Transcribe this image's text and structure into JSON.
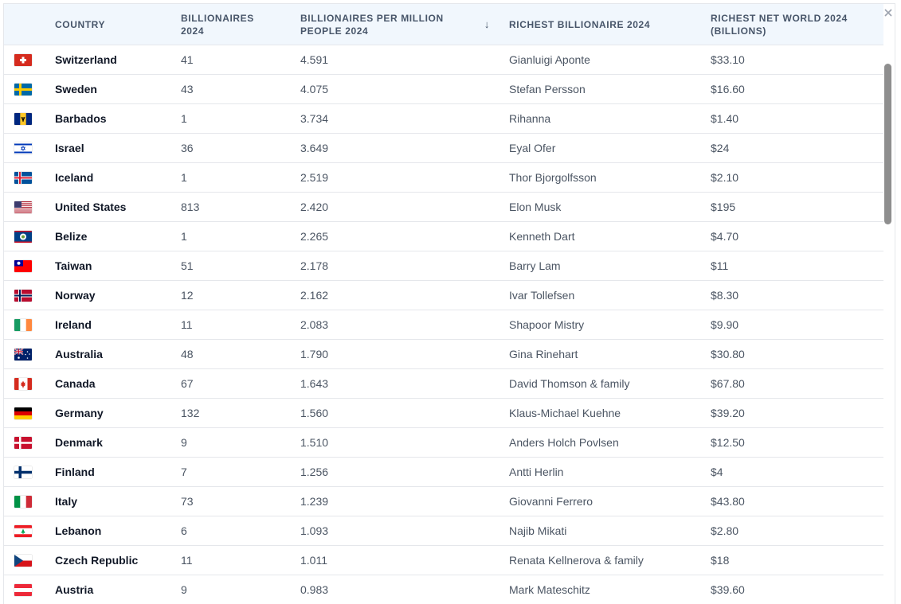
{
  "header": {
    "country": "COUNTRY",
    "billionaires_line1": "BILLIONAIRES",
    "billionaires_line2": "2024",
    "per_million_line1": "BILLIONAIRES PER MILLION",
    "per_million_line2": "PEOPLE 2024",
    "sort_icon": "↓",
    "richest": "RICHEST BILLIONAIRE 2024",
    "net_line1": "RICHEST NET WORLD 2024",
    "net_line2": "(BILLIONS)"
  },
  "rows": [
    {
      "flag": "switzerland",
      "country": "Switzerland",
      "billionaires": "41",
      "per_million": "4.591",
      "richest": "Gianluigi Aponte",
      "net": "$33.10"
    },
    {
      "flag": "sweden",
      "country": "Sweden",
      "billionaires": "43",
      "per_million": "4.075",
      "richest": "Stefan Persson",
      "net": "$16.60"
    },
    {
      "flag": "barbados",
      "country": "Barbados",
      "billionaires": "1",
      "per_million": "3.734",
      "richest": "Rihanna",
      "net": "$1.40"
    },
    {
      "flag": "israel",
      "country": "Israel",
      "billionaires": "36",
      "per_million": "3.649",
      "richest": "Eyal Ofer",
      "net": "$24"
    },
    {
      "flag": "iceland",
      "country": "Iceland",
      "billionaires": "1",
      "per_million": "2.519",
      "richest": "Thor Bjorgolfsson",
      "net": "$2.10"
    },
    {
      "flag": "united-states",
      "country": "United States",
      "billionaires": "813",
      "per_million": "2.420",
      "richest": "Elon Musk",
      "net": "$195"
    },
    {
      "flag": "belize",
      "country": "Belize",
      "billionaires": "1",
      "per_million": "2.265",
      "richest": "Kenneth Dart",
      "net": "$4.70"
    },
    {
      "flag": "taiwan",
      "country": "Taiwan",
      "billionaires": "51",
      "per_million": "2.178",
      "richest": "Barry Lam",
      "net": "$11"
    },
    {
      "flag": "norway",
      "country": "Norway",
      "billionaires": "12",
      "per_million": "2.162",
      "richest": "Ivar Tollefsen",
      "net": "$8.30"
    },
    {
      "flag": "ireland",
      "country": "Ireland",
      "billionaires": "11",
      "per_million": "2.083",
      "richest": "Shapoor Mistry",
      "net": "$9.90"
    },
    {
      "flag": "australia",
      "country": "Australia",
      "billionaires": "48",
      "per_million": "1.790",
      "richest": "Gina Rinehart",
      "net": "$30.80"
    },
    {
      "flag": "canada",
      "country": "Canada",
      "billionaires": "67",
      "per_million": "1.643",
      "richest": "David Thomson & family",
      "net": "$67.80"
    },
    {
      "flag": "germany",
      "country": "Germany",
      "billionaires": "132",
      "per_million": "1.560",
      "richest": "Klaus-Michael Kuehne",
      "net": "$39.20"
    },
    {
      "flag": "denmark",
      "country": "Denmark",
      "billionaires": "9",
      "per_million": "1.510",
      "richest": "Anders Holch Povlsen",
      "net": "$12.50"
    },
    {
      "flag": "finland",
      "country": "Finland",
      "billionaires": "7",
      "per_million": "1.256",
      "richest": "Antti Herlin",
      "net": "$4"
    },
    {
      "flag": "italy",
      "country": "Italy",
      "billionaires": "73",
      "per_million": "1.239",
      "richest": "Giovanni Ferrero",
      "net": "$43.80"
    },
    {
      "flag": "lebanon",
      "country": "Lebanon",
      "billionaires": "6",
      "per_million": "1.093",
      "richest": "Najib Mikati",
      "net": "$2.80"
    },
    {
      "flag": "czech-republic",
      "country": "Czech Republic",
      "billionaires": "11",
      "per_million": "1.011",
      "richest": "Renata Kellnerova & family",
      "net": "$18"
    },
    {
      "flag": "austria",
      "country": "Austria",
      "billionaires": "9",
      "per_million": "0.983",
      "richest": "Mark Mateschitz",
      "net": "$39.60"
    }
  ],
  "colors": {
    "header_bg": "#f1f7fd",
    "row_border": "#e5e7eb",
    "scrollbar": "#8e8e8e"
  }
}
